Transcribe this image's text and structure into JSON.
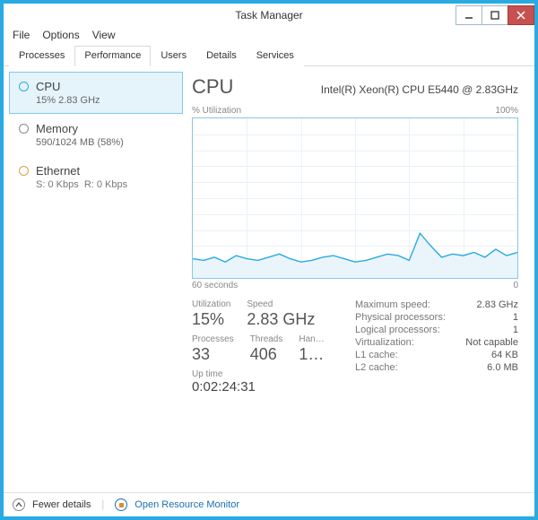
{
  "window": {
    "title": "Task Manager"
  },
  "menu": {
    "file": "File",
    "options": "Options",
    "view": "View"
  },
  "tabs": {
    "processes": "Processes",
    "performance": "Performance",
    "users": "Users",
    "details": "Details",
    "services": "Services"
  },
  "sidebar": {
    "cpu": {
      "title": "CPU",
      "sub": "15%   2.83 GHz"
    },
    "memory": {
      "title": "Memory",
      "sub": "590/1024 MB (58%)"
    },
    "ethernet": {
      "title": "Ethernet",
      "sub_s": "S: 0 Kbps",
      "sub_r": "R: 0 Kbps"
    }
  },
  "detail": {
    "title": "CPU",
    "model": "Intel(R) Xeon(R) CPU E5440 @ 2.83GHz",
    "chart_top_left": "% Utilization",
    "chart_top_right": "100%",
    "chart_bot_left": "60 seconds",
    "chart_bot_right": "0",
    "labels": {
      "utilization": "Utilization",
      "speed": "Speed",
      "processes": "Processes",
      "threads": "Threads",
      "handles": "Han…",
      "uptime": "Up time",
      "max_speed": "Maximum speed:",
      "phys_proc": "Physical processors:",
      "log_proc": "Logical processors:",
      "virt": "Virtualization:",
      "l1": "L1 cache:",
      "l2": "L2 cache:"
    },
    "values": {
      "utilization": "15%",
      "speed": "2.83 GHz",
      "processes": "33",
      "threads": "406",
      "handles": "1…",
      "uptime": "0:02:24:31",
      "max_speed": "2.83 GHz",
      "phys_proc": "1",
      "log_proc": "1",
      "virt": "Not capable",
      "l1": "64 KB",
      "l2": "6.0 MB"
    }
  },
  "footer": {
    "fewer": "Fewer details",
    "open_rm": "Open Resource Monitor"
  },
  "chart_data": {
    "type": "line",
    "title": "% Utilization",
    "xlabel": "seconds ago",
    "ylabel": "% Utilization",
    "xlim": [
      60,
      0
    ],
    "ylim": [
      0,
      100
    ],
    "x": [
      60,
      58,
      56,
      54,
      52,
      50,
      48,
      46,
      44,
      42,
      40,
      38,
      36,
      34,
      32,
      30,
      28,
      26,
      24,
      22,
      20,
      18,
      16,
      14,
      12,
      10,
      8,
      6,
      4,
      2,
      0
    ],
    "values": [
      12,
      11,
      13,
      10,
      14,
      12,
      11,
      13,
      15,
      12,
      10,
      11,
      13,
      14,
      12,
      10,
      11,
      13,
      15,
      14,
      11,
      28,
      20,
      13,
      15,
      14,
      16,
      13,
      18,
      14,
      16
    ]
  }
}
